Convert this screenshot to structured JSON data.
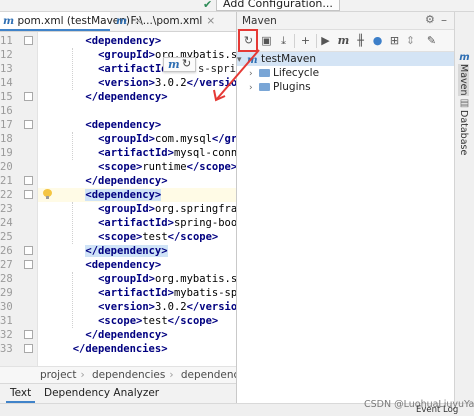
{
  "toolbar": {
    "add_configuration": "Add Configuration..."
  },
  "tabs": [
    {
      "icon": "m",
      "label": "pom.xml (testMaven)",
      "close": "×"
    },
    {
      "icon": "m",
      "label": "F:\\...\\pom.xml",
      "close": "×"
    }
  ],
  "editor": {
    "lines": [
      {
        "num": "11",
        "indent": 4,
        "text": "<dependency>"
      },
      {
        "num": "12",
        "indent": 6,
        "text": "<groupId>org.mybatis.sprin"
      },
      {
        "num": "13",
        "indent": 6,
        "text": "<artifactId>"
      },
      {
        "num": "14",
        "indent": 6,
        "text": "<version>3.0.2</version>"
      },
      {
        "num": "15",
        "indent": 4,
        "text": "</dependency>"
      },
      {
        "num": "16",
        "indent": 0,
        "text": ""
      },
      {
        "num": "17",
        "indent": 4,
        "text": "<dependency>"
      },
      {
        "num": "18",
        "indent": 6,
        "text": "<groupId>com.mysql</group"
      },
      {
        "num": "19",
        "indent": 6,
        "text": "<artifactId>mysql-connect"
      },
      {
        "num": "20",
        "indent": 6,
        "text": "<scope>runtime</scope>"
      },
      {
        "num": "21",
        "indent": 4,
        "text": "</dependency>"
      },
      {
        "num": "22",
        "indent": 4,
        "text": "<dependency>"
      },
      {
        "num": "23",
        "indent": 6,
        "text": "<groupId>org.springframew"
      },
      {
        "num": "24",
        "indent": 6,
        "text": "<artifactId>spring-boot-s"
      },
      {
        "num": "25",
        "indent": 6,
        "text": "<scope>test</scope>"
      },
      {
        "num": "26",
        "indent": 4,
        "text": "</dependency>"
      },
      {
        "num": "27",
        "indent": 4,
        "text": "<dependency>"
      },
      {
        "num": "28",
        "indent": 6,
        "text": "<groupId>org.mybatis.sprin"
      },
      {
        "num": "29",
        "indent": 6,
        "text": "<artifactId>mybatis-sprin"
      },
      {
        "num": "30",
        "indent": 6,
        "text": "<version>3.0.2</version>"
      },
      {
        "num": "31",
        "indent": 6,
        "text": "<scope>test</scope>"
      },
      {
        "num": "32",
        "indent": 4,
        "text": "</dependency>"
      },
      {
        "num": "33",
        "indent": 2,
        "text": "</dependencies>"
      }
    ],
    "popup_suffix": "s-sprin"
  },
  "breadcrumb": [
    "project",
    "dependencies",
    "dependency"
  ],
  "bottom_tabs": [
    "Text",
    "Dependency Analyzer"
  ],
  "maven": {
    "title": "Maven",
    "root": "testMaven",
    "children": [
      "Lifecycle",
      "Plugins"
    ]
  },
  "right_strip": [
    "Maven",
    "Database"
  ],
  "status": {
    "watermark": "CSDN @LuohuaLiuyuYan",
    "event_log": "Event Log"
  },
  "colors": {
    "tag": "#000080",
    "selection": "#cfe3f7",
    "highlight_line": "#fffbe6",
    "annotation_red": "#e53935",
    "tree_selection": "#d4e4f5"
  }
}
